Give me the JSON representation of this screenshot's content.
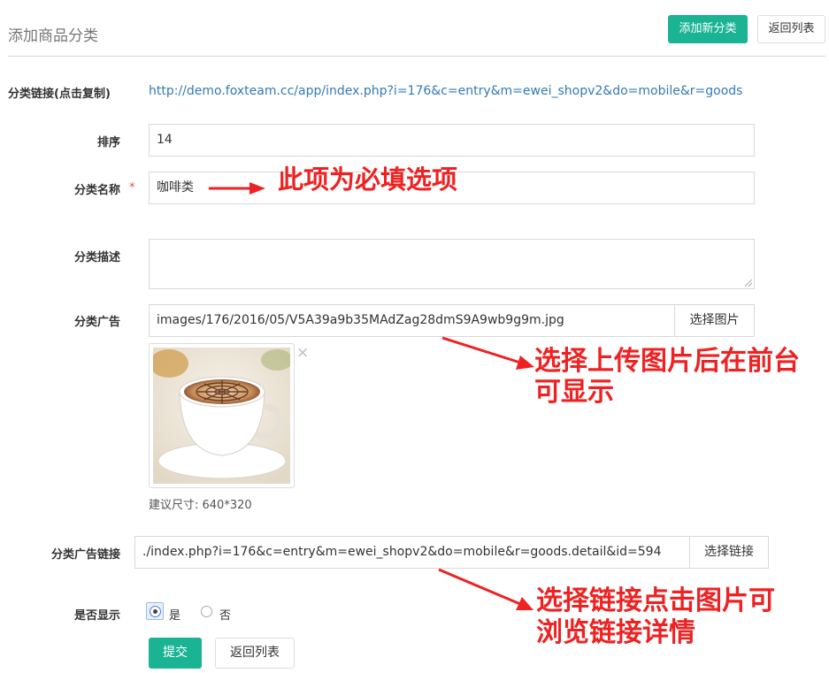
{
  "header": {
    "title": "添加商品分类",
    "add_button": "添加新分类",
    "back_button": "返回列表"
  },
  "form": {
    "link": {
      "label": "分类链接(点击复制)",
      "value": "http://demo.foxteam.cc/app/index.php?i=176&c=entry&m=ewei_shopv2&do=mobile&r=goods"
    },
    "sort": {
      "label": "排序",
      "value": "14"
    },
    "name": {
      "label": "分类名称",
      "required": "*",
      "value": "咖啡类"
    },
    "description": {
      "label": "分类描述",
      "value": ""
    },
    "ad": {
      "label": "分类广告",
      "value": "images/176/2016/05/V5A39a9b35MAdZag28dmS9A9wb9g9m.jpg",
      "select_button": "选择图片",
      "close_glyph": "×",
      "hint": "建议尺寸: 640*320"
    },
    "ad_link": {
      "label": "分类广告链接",
      "value": "./index.php?i=176&c=entry&m=ewei_shopv2&do=mobile&r=goods.detail&id=594",
      "select_button": "选择链接"
    },
    "display": {
      "label": "是否显示",
      "options": [
        "是",
        "否"
      ],
      "selected": "是"
    },
    "submit_button": "提交",
    "back_button": "返回列表"
  },
  "annotations": {
    "required_note": "此项为必填选项",
    "image_note_line1": "选择上传图片后在前台",
    "image_note_line2": "可显示",
    "link_note_line1": "选择链接点击图片可",
    "link_note_line2": "浏览链接详情",
    "color": "#ee2222"
  },
  "colors": {
    "primary": "#1ab394",
    "link": "#337ab7",
    "required": "#e74c3c"
  },
  "icons": [
    "close-icon",
    "arrow-icon",
    "resize-grip-icon"
  ]
}
